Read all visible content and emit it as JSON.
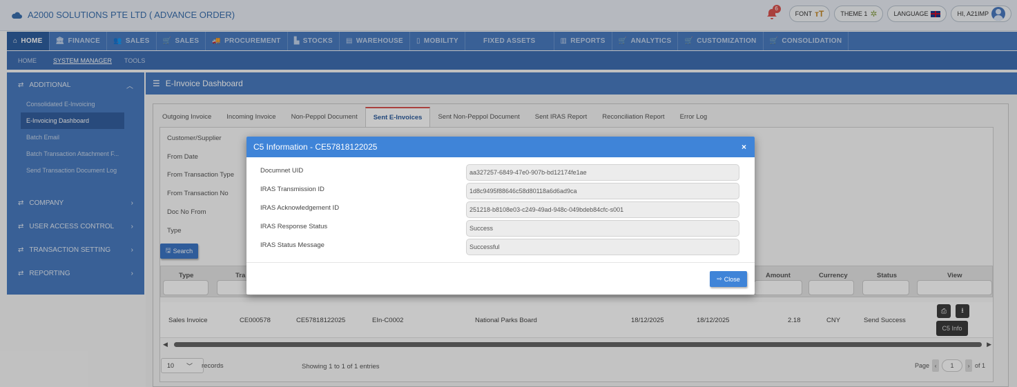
{
  "app": {
    "title": "A2000 SOLUTIONS PTE LTD ( ADVANCE ORDER)",
    "notification_count": "6"
  },
  "top_controls": {
    "font": "FONT",
    "theme": "THEME 1",
    "language": "LANGUAGE",
    "user": "HI, A21IMP"
  },
  "modules": [
    {
      "label": "HOME",
      "icon": "home-icon"
    },
    {
      "label": "FINANCE",
      "icon": "bank-icon"
    },
    {
      "label": "SALES",
      "icon": "users-icon"
    },
    {
      "label": "SALES",
      "icon": "cart-icon"
    },
    {
      "label": "PROCUREMENT",
      "icon": "truck-icon"
    },
    {
      "label": "STOCKS",
      "icon": "chart-icon"
    },
    {
      "label": "WAREHOUSE",
      "icon": "warehouse-icon"
    },
    {
      "label": "MOBILITY",
      "icon": "mobile-icon"
    },
    {
      "label": "FIXED ASSETS",
      "icon": ""
    },
    {
      "label": "REPORTS",
      "icon": "bar-chart-icon"
    },
    {
      "label": "ANALYTICS",
      "icon": "cart-icon"
    },
    {
      "label": "CUSTOMIZATION",
      "icon": "cart-icon"
    },
    {
      "label": "CONSOLIDATION",
      "icon": "cart-icon"
    }
  ],
  "subnav": [
    "HOME",
    "SYSTEM MANAGER",
    "TOOLS"
  ],
  "sidebar": {
    "header": "ADDITIONAL",
    "items": [
      "Consolidated E-Invoicing",
      "E-Invoicing Dashboard",
      "Batch Email",
      "Batch Transaction Attachment F...",
      "Send Transaction Document Log"
    ],
    "groups": [
      "COMPANY",
      "USER ACCESS CONTROL",
      "TRANSACTION SETTING",
      "REPORTING"
    ]
  },
  "main": {
    "title": "E-Invoice Dashboard",
    "tabs": [
      "Outgoing Invoice",
      "Incoming Invoice",
      "Non-Peppol Document",
      "Sent E-Invoices",
      "Sent Non-Peppol Document",
      "Sent IRAS Report",
      "Reconciliation Report",
      "Error Log"
    ],
    "form_labels": [
      "Customer/Supplier",
      "From Date",
      "From Transaction Type",
      "From Transaction No",
      "Doc No From",
      "Type"
    ],
    "search_label": "Search"
  },
  "grid": {
    "columns": {
      "type": "Type",
      "tra": "Tra",
      "amount": "Amount",
      "currency": "Currency",
      "status": "Status",
      "view": "View"
    },
    "row": {
      "type": "Sales Invoice",
      "doc_no": "CE000578",
      "c5_no": "CE57818122025",
      "einv": "EIn-C0002",
      "customer": "National Parks Board",
      "date1": "18/12/2025",
      "date2": "18/12/2025",
      "amount": "2.18",
      "currency": "CNY",
      "status": "Send Success"
    },
    "tooltip": "C5 Info",
    "records_value": "10",
    "records_label": "records",
    "showing": "Showing 1 to 1 of 1 entries",
    "page_label": "Page",
    "page_value": "1",
    "page_of": "of 1"
  },
  "modal": {
    "title": "C5 Information - CE57818122025",
    "fields": [
      {
        "label": "Documnet UID",
        "value": "aa327257-6849-47e0-907b-bd12174fe1ae"
      },
      {
        "label": "IRAS Transmission ID",
        "value": "1d8c9495f88646c58d80118a6d6ad9ca"
      },
      {
        "label": "IRAS Acknowledgement ID",
        "value": "251218-b8108e03-c249-49ad-948c-049bdeb84cfc-s001"
      },
      {
        "label": "IRAS Response Status",
        "value": "Success"
      },
      {
        "label": "IRAS Status Message",
        "value": "Successful"
      }
    ],
    "close_label": "Close"
  }
}
